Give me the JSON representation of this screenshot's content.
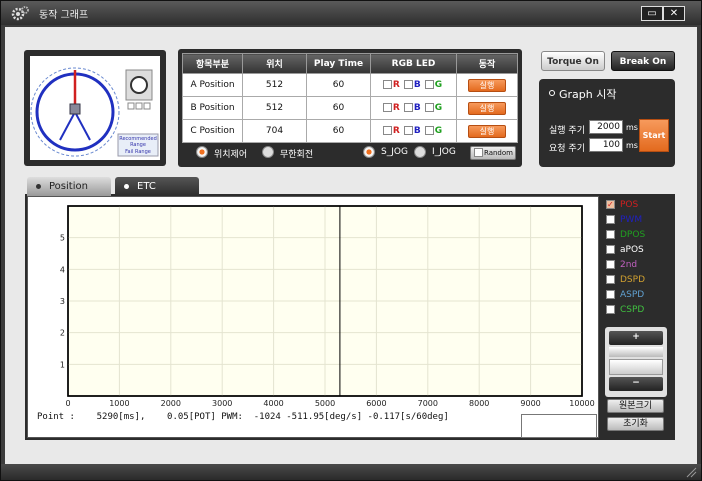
{
  "window": {
    "title": "동작 그래프",
    "restore_glyph": "▭",
    "close_glyph": "✕"
  },
  "table": {
    "headers": [
      "항목부분",
      "위치",
      "Play Time",
      "RGB LED",
      "동작"
    ],
    "rows": [
      {
        "name": "A Position",
        "pos": "512",
        "time": "60",
        "run": "실행"
      },
      {
        "name": "B Position",
        "pos": "512",
        "time": "60",
        "run": "실행"
      },
      {
        "name": "C Position",
        "pos": "704",
        "time": "60",
        "run": "실행"
      }
    ],
    "led_r": "R",
    "led_b": "B",
    "led_g": "G"
  },
  "servo": {
    "recommended": "Recommended Range",
    "fail": "Fail Range"
  },
  "radios": {
    "pos_ctrl": "위치제어",
    "infinite": "무한회전",
    "s_jog": "S_JOG",
    "i_jog": "I_JOG",
    "random": "Random"
  },
  "buttons": {
    "torque_on": "Torque On",
    "break_on": "Break On",
    "start": "Start",
    "zoom_in": "+",
    "zoom_out": "−",
    "original": "원본크기",
    "reset": "초기화"
  },
  "graph": {
    "title": "Graph 시작",
    "run_period_label": "실행 주기",
    "run_period_value": "2000",
    "run_period_unit": "ms",
    "req_period_label": "요청 주기",
    "req_period_value": "100",
    "req_period_unit": "ms"
  },
  "tabs": [
    "Position",
    "ETC"
  ],
  "legend": [
    {
      "label": "POS",
      "color": "#d02020",
      "checked": true
    },
    {
      "label": "PWM",
      "color": "#2020c0",
      "checked": false
    },
    {
      "label": "DPOS",
      "color": "#20a020",
      "checked": false
    },
    {
      "label": "aPOS",
      "color": "#ffffff",
      "checked": false
    },
    {
      "label": "2nd",
      "color": "#c060c0",
      "checked": false
    },
    {
      "label": "DSPD",
      "color": "#d0a030",
      "checked": false
    },
    {
      "label": "ASPD",
      "color": "#60a0d0",
      "checked": false
    },
    {
      "label": "CSPD",
      "color": "#40c040",
      "checked": false
    }
  ],
  "chart_data": {
    "type": "line",
    "xlim": [
      0,
      10000
    ],
    "ylim": [
      0,
      6
    ],
    "x_ticks": [
      "0",
      "1000",
      "2000",
      "3000",
      "4000",
      "5000",
      "6000",
      "7000",
      "8000",
      "9000",
      "10000"
    ],
    "y_ticks": [
      "1",
      "2",
      "3",
      "4",
      "5"
    ],
    "cursor_x": 5290,
    "grid": true,
    "series": []
  },
  "readout": "Point :    5290[ms],    0.05[POT] PWM:  -1024 -511.95[deg/s] -0.117[s/60deg]"
}
